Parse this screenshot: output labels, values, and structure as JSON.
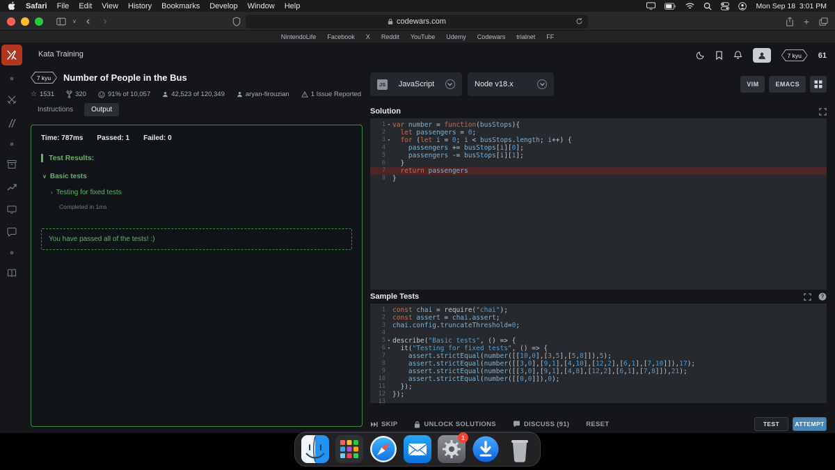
{
  "menubar": {
    "items": [
      "Safari",
      "File",
      "Edit",
      "View",
      "History",
      "Bookmarks",
      "Develop",
      "Window",
      "Help"
    ],
    "clock": "Mon Sep 18  3:01 PM"
  },
  "toolbar": {
    "url": "codewars.com"
  },
  "bookmarks_bar": {
    "items": [
      "NintendoLife",
      "Facebook",
      "X",
      "Reddit",
      "YouTube",
      "Udemy",
      "Codewars",
      "trialnet",
      "FF"
    ]
  },
  "topbar": {
    "title": "Kata Training",
    "rank_badge": "7 kyu",
    "honor": "61"
  },
  "kata": {
    "rank": "7 kyu",
    "title": "Number of People in the Bus",
    "stats": {
      "stars": "1531",
      "forks": "320",
      "satisfaction": "91% of 10,057",
      "completed": "42,523 of 120,349",
      "author": "aryan-firouzian",
      "issues": "1 Issue Reported"
    },
    "tabs": [
      {
        "label": "Instructions",
        "active": false
      },
      {
        "label": "Output",
        "active": true
      }
    ]
  },
  "output": {
    "time": "Time: 787ms",
    "passed": "Passed: 1",
    "failed": "Failed: 0",
    "heading": "Test Results:",
    "group": "Basic tests",
    "case": "Testing for fixed tests",
    "completed_in": "Completed in 1ms",
    "success_message": "You have passed all of the tests! :)"
  },
  "editor": {
    "language": "JavaScript",
    "language_badge": "JS",
    "runtime": "Node v18.x",
    "vim": "VIM",
    "emacs": "EMACS"
  },
  "solution": {
    "title": "Solution",
    "active_line": 7,
    "fold_lines": [
      1,
      3
    ],
    "lines": [
      "var number = function(busStops){",
      "  let passengers = 0;",
      "  for (let i = 0; i < busStops.length; i++) {",
      "    passengers += busStops[i][0];",
      "    passengers -= busStops[i][1];",
      "  }",
      "  return passengers",
      "}"
    ]
  },
  "sample_tests": {
    "title": "Sample Tests",
    "fold_lines": [
      5,
      6
    ],
    "lines": [
      "const chai = require(\"chai\");",
      "const assert = chai.assert;",
      "chai.config.truncateThreshold=0;",
      "",
      "describe(\"Basic tests\", () => {",
      "  it(\"Testing for fixed tests\", () => {",
      "    assert.strictEqual(number([[10,0],[3,5],[5,8]]),5);",
      "    assert.strictEqual(number([[3,0],[9,1],[4,10],[12,2],[6,1],[7,10]]),17);",
      "    assert.strictEqual(number([[3,0],[9,1],[4,8],[12,2],[6,1],[7,8]]),21);",
      "    assert.strictEqual(number([[0,0]]),0);",
      "  });",
      "});",
      ""
    ]
  },
  "actions": {
    "skip": "SKIP",
    "unlock": "UNLOCK SOLUTIONS",
    "discuss": "DISCUSS (91)",
    "reset": "RESET",
    "test": "TEST",
    "attempt": "ATTEMPT"
  },
  "rail": {
    "icons": [
      "dot",
      "swords",
      "sticks",
      "dot",
      "archive",
      "trend",
      "screen",
      "chat",
      "dot",
      "book"
    ]
  },
  "dock": {
    "items": [
      "finder",
      "launchpad",
      "safari",
      "mail",
      "settings",
      "downloads",
      "trash"
    ],
    "badge": "1"
  },
  "colors": {
    "accent_green": "#5fb766",
    "border_green": "#3e8c44",
    "logo_red": "#b1361e",
    "attempt_blue": "#4a86b8",
    "active_line_bg": "#4c2528"
  }
}
